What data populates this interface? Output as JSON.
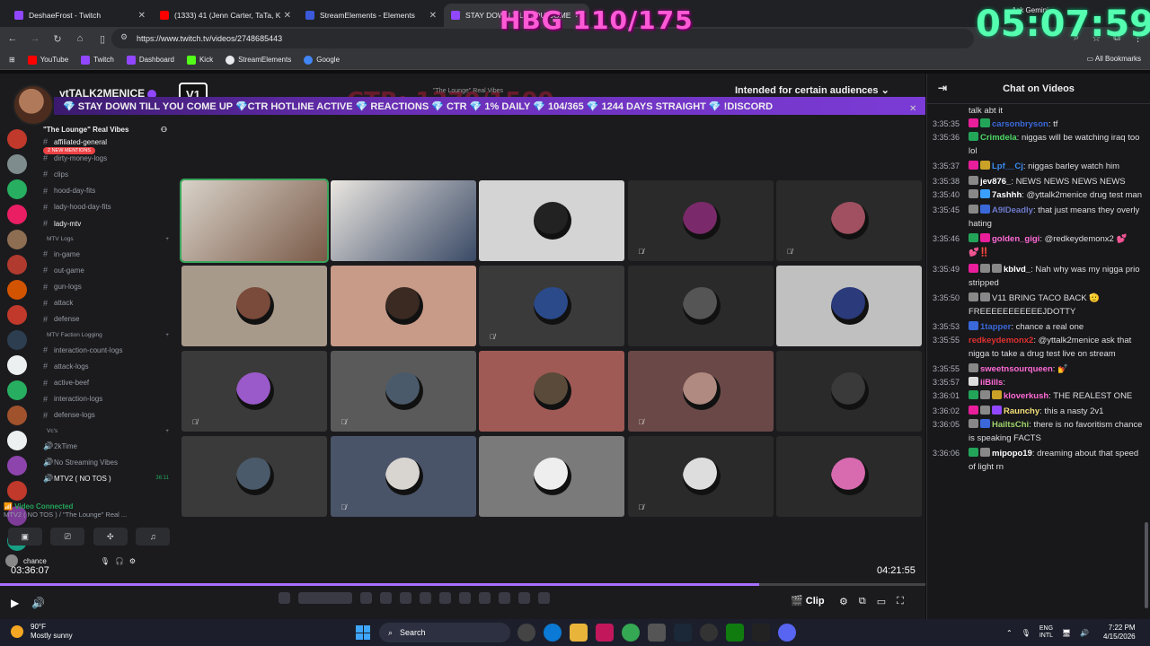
{
  "browser": {
    "tabs": [
      {
        "title": "DeshaeFrost - Twitch",
        "color": "#9147ff"
      },
      {
        "title": "(1333) 41 (Jenn Carter, TaTa, Ky",
        "color": "#ff0000"
      },
      {
        "title": "StreamElements - Elements",
        "color": "#1e2a4a"
      },
      {
        "title": "STAY DOWN TILL YOU COME",
        "color": "#9147ff"
      }
    ],
    "url": "https://www.twitch.tv/videos/2748685443",
    "bookmarks": [
      "YouTube",
      "Twitch",
      "Dashboard",
      "Kick",
      "StreamElements",
      "Google"
    ],
    "all_bookmarks": "All Bookmarks",
    "ask_gemini": "Ask Gemini"
  },
  "overlay": {
    "hbg": "HBG 110/175",
    "clock": "05:07:59",
    "ctr_ghost": "CTR: 1370/1500",
    "lounge_ghost": "\"The Lounge\" Real Vibes"
  },
  "player": {
    "streamer": "ytTALK2MENICE",
    "vlogo": "V1",
    "ticker": "💎 STAY DOWN TILL YOU COME UP 💎CTR HOTLINE ACTIVE 💎 REACTIONS 💎 CTR 💎 1% DAILY 💎 104/365 💎 1244 DAYS STRAIGHT 💎 !DISCORD",
    "audience": "Intended for certain audiences",
    "elapsed": "03:36:07",
    "duration": "04:21:55",
    "progress": 0.82,
    "clip": "Clip"
  },
  "discord": {
    "server_name": "\"The Lounge\" Real Vibes",
    "mentions": "2 NEW MENTIONS",
    "channels": [
      {
        "name": "affiliated-general",
        "type": "text",
        "bright": true
      },
      {
        "name": "dirty-money-logs",
        "type": "text"
      },
      {
        "name": "clips",
        "type": "text"
      },
      {
        "name": "hood-day-fits",
        "type": "text"
      },
      {
        "name": "lady-hood-day-fits",
        "type": "text"
      },
      {
        "name": "lady-mtv",
        "type": "text",
        "bright": true
      },
      {
        "name": "MTV Logs",
        "type": "category"
      },
      {
        "name": "in-game",
        "type": "text"
      },
      {
        "name": "out-game",
        "type": "text"
      },
      {
        "name": "gun-logs",
        "type": "text"
      },
      {
        "name": "attack",
        "type": "text"
      },
      {
        "name": "defense",
        "type": "text"
      },
      {
        "name": "MTV Faction Logging",
        "type": "category"
      },
      {
        "name": "interaction-count-logs",
        "type": "text"
      },
      {
        "name": "attack-logs",
        "type": "text"
      },
      {
        "name": "active-beef",
        "type": "text"
      },
      {
        "name": "interaction-logs",
        "type": "text"
      },
      {
        "name": "defense-logs",
        "type": "text"
      },
      {
        "name": "Vc's",
        "type": "category"
      },
      {
        "name": "2kTime",
        "type": "voice"
      },
      {
        "name": "No Streaming Vibes",
        "type": "voice"
      },
      {
        "name": "MTV2 ( NO TOS )",
        "type": "voice",
        "bright": true
      }
    ],
    "voice_timer": "36:11",
    "video_connected": "Video Connected",
    "voice_sub": "MTV2 ( NO TOS ) / \"The Lounge\" Real ...",
    "user": "chance"
  },
  "chat": {
    "title": "Chat on Videos",
    "messages": [
      {
        "ts": "",
        "user": "",
        "color": "#dedee3",
        "text": "talk abt it",
        "badges": []
      },
      {
        "ts": "3:35:35",
        "user": "carsonbryson",
        "color": "#3a68d9",
        "text": "tf",
        "badges": [
          "#e91e9b",
          "#23a559"
        ]
      },
      {
        "ts": "3:35:36",
        "user": "Crimdela",
        "color": "#4cd964",
        "text": "niggas will be watching iraq too lol",
        "badges": [
          "#23a559"
        ]
      },
      {
        "ts": "3:35:37",
        "user": "Lpf__Cj",
        "color": "#3a8cf0",
        "text": "niggas barley watch him",
        "badges": [
          "#e91e9b",
          "#c9a227"
        ]
      },
      {
        "ts": "3:35:38",
        "user": "jev876_",
        "color": "#ffffff",
        "text": "NEWS NEWS NEWS NEWS",
        "badges": [
          "#888888"
        ]
      },
      {
        "ts": "3:35:40",
        "user": "7ashhh",
        "color": "#ffffff",
        "text": "@yttalk2menice drug test man",
        "badges": [
          "#888888",
          "#3aa0ff"
        ]
      },
      {
        "ts": "3:35:45",
        "user": "A9IDeadly",
        "color": "#6d7ac9",
        "text": "that just means they overly hating",
        "badges": [
          "#888888",
          "#3a68d9"
        ]
      },
      {
        "ts": "3:35:46",
        "user": "golden_gigi",
        "color": "#ff6ad5",
        "text": "@redkeydemonx2 💕💕‼️",
        "badges": [
          "#23a559",
          "#e91e9b"
        ]
      },
      {
        "ts": "3:35:49",
        "user": "kblvd_",
        "color": "#ffffff",
        "text": "Nah why was my nigga prio stripped",
        "badges": [
          "#e91e9b",
          "#888888",
          "#888888"
        ]
      },
      {
        "ts": "3:35:50",
        "user": "",
        "color": "#2c2cff",
        "text": "V11 BRING TACO BACK 🫡 FREEEEEEEEEEEJDOTTY",
        "badges": [
          "#888888",
          "#888888"
        ]
      },
      {
        "ts": "3:35:53",
        "user": "1tapper",
        "color": "#3a68d9",
        "text": "chance a real one",
        "badges": [
          "#3a68d9"
        ]
      },
      {
        "ts": "3:35:55",
        "user": "redkeydemonx2",
        "color": "#e0302e",
        "text": "@yttalk2menice ask that nigga to take a drug test live on stream",
        "badges": []
      },
      {
        "ts": "3:35:55",
        "user": "sweetnsourqueen",
        "color": "#ff6ad5",
        "text": "💅",
        "badges": [
          "#888888"
        ]
      },
      {
        "ts": "3:35:57",
        "user": "iiBills",
        "color": "#ff6ad5",
        "text": "",
        "badges": [
          "#dddddd"
        ]
      },
      {
        "ts": "3:36:01",
        "user": "kloverkush",
        "color": "#ff6ad5",
        "text": "THE REALEST ONE",
        "badges": [
          "#23a559",
          "#888888",
          "#c9a227"
        ]
      },
      {
        "ts": "3:36:02",
        "user": "Raunchy",
        "color": "#f5e07a",
        "text": "this a nasty 2v1",
        "badges": [
          "#e91e9b",
          "#888888",
          "#9147ff"
        ]
      },
      {
        "ts": "3:36:05",
        "user": "HailtsChi",
        "color": "#9ed36a",
        "text": "there is no favoritism chance is speaking FACTS",
        "badges": [
          "#888888",
          "#3a68d9"
        ]
      },
      {
        "ts": "3:36:06",
        "user": "mipopo19",
        "color": "#ffffff",
        "text": "dreaming about that speed of light rn",
        "badges": [
          "#23a559",
          "#888888"
        ]
      }
    ]
  },
  "taskbar": {
    "temp": "90°F",
    "weather": "Mostly sunny",
    "search": "Search",
    "lang1": "ENG",
    "lang2": "INTL",
    "time": "7:22 PM",
    "date": "4/15/2026"
  }
}
